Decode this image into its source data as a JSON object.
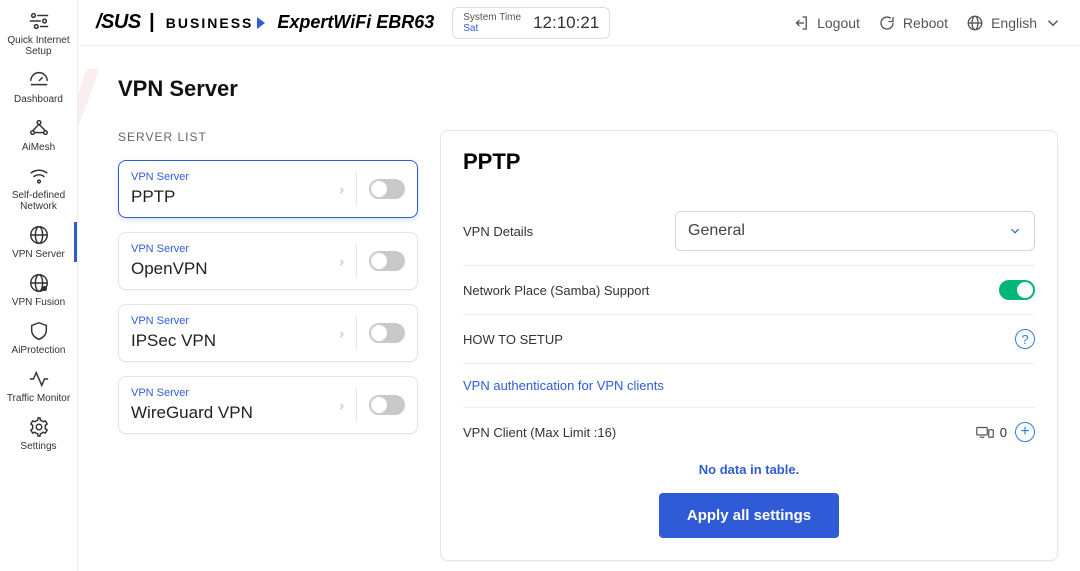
{
  "header": {
    "brand_main": "/SUS",
    "brand_sep": " | ",
    "brand_sub": "BUSINESS",
    "product": "ExpertWiFi EBR63",
    "systime_label": "System Time",
    "systime_day": "Sat",
    "systime_clock": "12:10:21",
    "logout": "Logout",
    "reboot": "Reboot",
    "language": "English"
  },
  "sidebar": {
    "items": [
      {
        "label": "Quick Internet Setup"
      },
      {
        "label": "Dashboard"
      },
      {
        "label": "AiMesh"
      },
      {
        "label": "Self-defined Network"
      },
      {
        "label": "VPN Server"
      },
      {
        "label": "VPN Fusion"
      },
      {
        "label": "AiProtection"
      },
      {
        "label": "Traffic Monitor"
      },
      {
        "label": "Settings"
      }
    ],
    "active_index": 4
  },
  "page": {
    "title": "VPN Server",
    "list_label": "SERVER LIST",
    "servers": [
      {
        "eyebrow": "VPN Server",
        "name": "PPTP",
        "on": false,
        "selected": true
      },
      {
        "eyebrow": "VPN Server",
        "name": "OpenVPN",
        "on": false,
        "selected": false
      },
      {
        "eyebrow": "VPN Server",
        "name": "IPSec VPN",
        "on": false,
        "selected": false
      },
      {
        "eyebrow": "VPN Server",
        "name": "WireGuard VPN",
        "on": false,
        "selected": false
      }
    ]
  },
  "panel": {
    "title": "PPTP",
    "details_label": "VPN Details",
    "details_value": "General",
    "samba_label": "Network Place (Samba) Support",
    "samba_on": true,
    "howto_label": "HOW TO SETUP",
    "auth_link": "VPN authentication for VPN clients",
    "client_label": "VPN Client (Max Limit :16)",
    "client_count": "0",
    "no_data": "No data in table.",
    "apply": "Apply all settings"
  }
}
